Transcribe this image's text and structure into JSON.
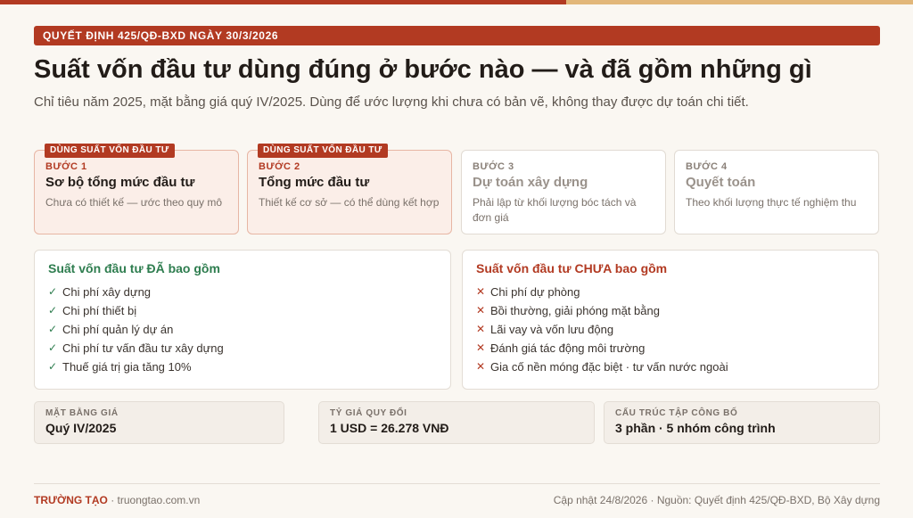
{
  "colors": {
    "accent": "#b23a22",
    "gold": "#e2b77a",
    "included": "#2e7d4f",
    "background": "#faf7f2"
  },
  "banner": "QUYẾT ĐỊNH 425/QĐ-BXD NGÀY 30/3/2026",
  "title": "Suất vốn đầu tư dùng đúng ở bước nào — và đã gồm những gì",
  "subtitle": "Chỉ tiêu năm 2025, mặt bằng giá quý IV/2025. Dùng để ước lượng khi chưa có bản vẽ, không thay được dự toán chi tiết.",
  "steps": [
    {
      "tag": "DÙNG SUẤT VỐN ĐẦU TƯ",
      "num": "BƯỚC 1",
      "name": "Sơ bộ tổng mức đầu tư",
      "desc": "Chưa có thiết kế — ước theo quy mô",
      "active": true
    },
    {
      "tag": "DÙNG SUẤT VỐN ĐẦU TƯ",
      "num": "BƯỚC 2",
      "name": "Tổng mức đầu tư",
      "desc": "Thiết kế cơ sở — có thể dùng kết hợp",
      "active": true
    },
    {
      "tag": "",
      "num": "BƯỚC 3",
      "name": "Dự toán xây dựng",
      "desc": "Phải lập từ khối lượng bóc tách và đơn giá",
      "active": false
    },
    {
      "tag": "",
      "num": "BƯỚC 4",
      "name": "Quyết toán",
      "desc": "Theo khối lượng thực tế nghiệm thu",
      "active": false
    }
  ],
  "included": {
    "title": "Suất vốn đầu tư ĐÃ bao gồm",
    "mark": "✓",
    "items": [
      "Chi phí xây dựng",
      "Chi phí thiết bị",
      "Chi phí quản lý dự án",
      "Chi phí tư vấn đầu tư xây dựng",
      "Thuế giá trị gia tăng 10%"
    ]
  },
  "excluded": {
    "title": "Suất vốn đầu tư CHƯA bao gồm",
    "mark": "✕",
    "items": [
      "Chi phí dự phòng",
      "Bồi thường, giải phóng mặt bằng",
      "Lãi vay và vốn lưu động",
      "Đánh giá tác động môi trường",
      "Gia cố nền móng đặc biệt · tư vấn nước ngoài"
    ]
  },
  "stats": [
    {
      "label": "MẶT BẰNG GIÁ",
      "value": "Quý IV/2025"
    },
    {
      "label": "TỶ GIÁ QUY ĐỔI",
      "value": "1 USD = 26.278 VNĐ"
    },
    {
      "label": "CẤU TRÚC TẬP CÔNG BỐ",
      "value": "3 phần · 5 nhóm công trình"
    }
  ],
  "footer": {
    "brand": "TRƯỜNG TẠO",
    "site": " · truongtao.com.vn",
    "note": "Cập nhật 24/8/2026 · Nguồn: Quyết định 425/QĐ-BXD, Bộ Xây dựng"
  }
}
